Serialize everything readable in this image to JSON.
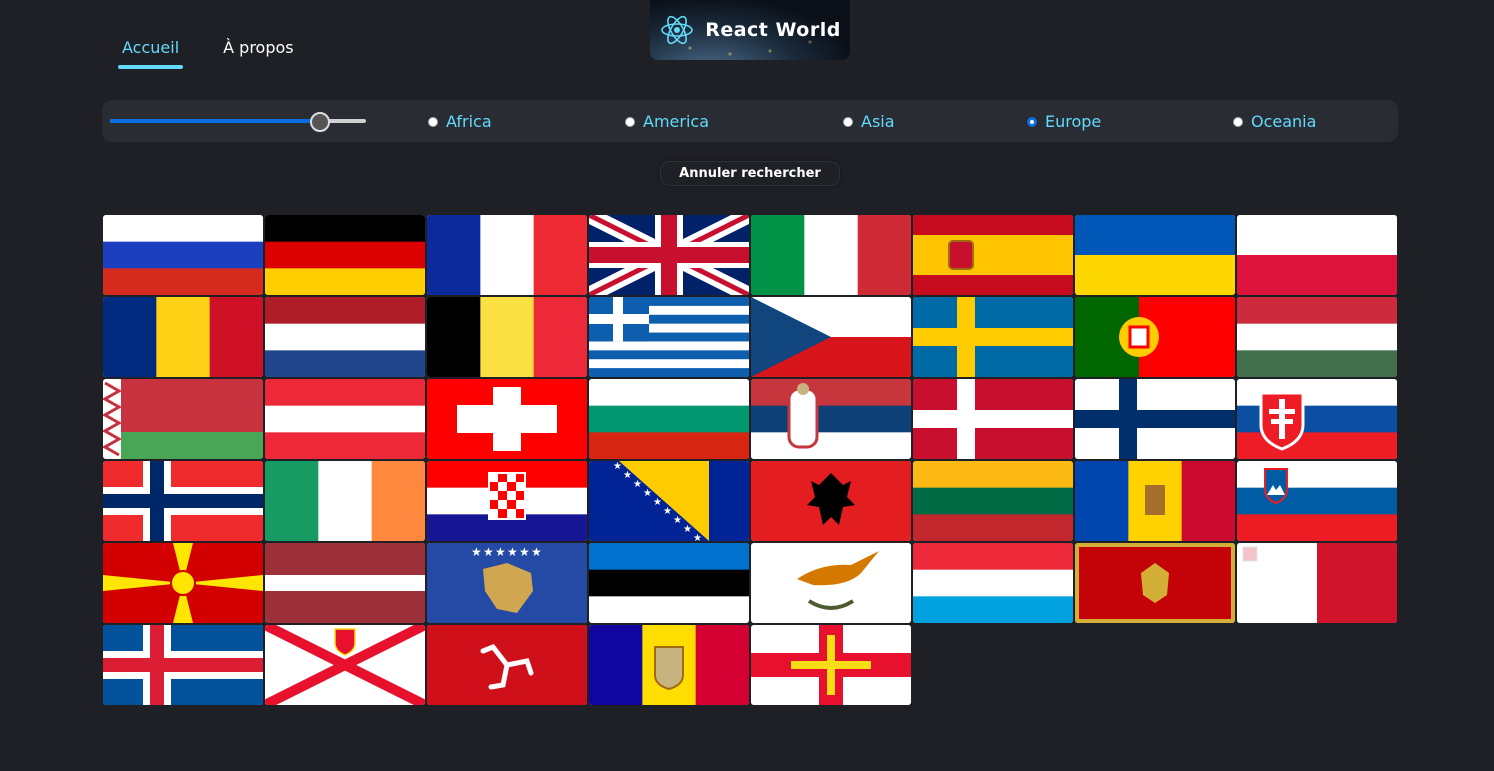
{
  "nav": {
    "links": [
      {
        "label": "Accueil",
        "active": true
      },
      {
        "label": "À propos",
        "active": false
      }
    ]
  },
  "logo": {
    "text": "React World",
    "icon": "react-atom-icon"
  },
  "filters": {
    "slider_value": 0.82,
    "regions": [
      "Africa",
      "America",
      "Asia",
      "Europe",
      "Oceania"
    ],
    "selected_region": "Europe",
    "cancel_label": "Annuler rechercher"
  },
  "colors": {
    "accent": "#61dafb",
    "background": "#1f2026",
    "panel": "#2a2c34",
    "slider": "#0b6de0"
  },
  "flags": [
    "Russia",
    "Germany",
    "France",
    "United Kingdom",
    "Italy",
    "Spain",
    "Ukraine",
    "Poland",
    "Romania",
    "Netherlands",
    "Belgium",
    "Greece",
    "Czechia",
    "Sweden",
    "Portugal",
    "Hungary",
    "Belarus",
    "Austria",
    "Switzerland",
    "Bulgaria",
    "Serbia",
    "Denmark",
    "Finland",
    "Slovakia",
    "Norway",
    "Ireland",
    "Croatia",
    "Bosnia and Herzegovina",
    "Albania",
    "Lithuania",
    "Moldova",
    "Slovenia",
    "North Macedonia",
    "Latvia",
    "Kosovo",
    "Estonia",
    "Cyprus",
    "Luxembourg",
    "Montenegro",
    "Malta",
    "Iceland",
    "Jersey",
    "Isle of Man",
    "Andorra",
    "Guernsey"
  ]
}
